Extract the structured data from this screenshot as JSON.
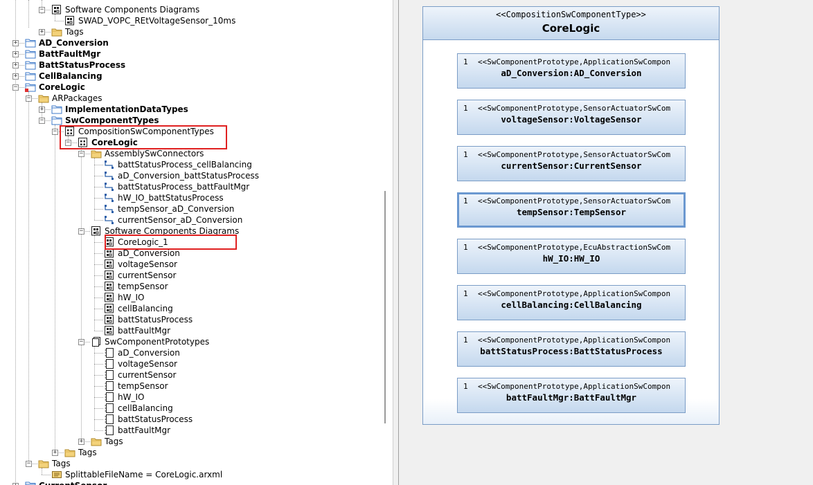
{
  "tree": {
    "nodes": [
      {
        "label": "Software Components Diagrams",
        "icon": "diagram-icon",
        "toggle": "-",
        "bold": false
      },
      {
        "label": "SWAD_VOPC_REtVoltageSensor_10ms",
        "icon": "diagram-icon",
        "toggle": "",
        "bold": false
      },
      {
        "label": "Tags",
        "icon": "tags-folder-icon",
        "toggle": "+",
        "bold": false
      },
      {
        "label": "AD_Conversion",
        "icon": "package-folder-icon",
        "toggle": "+",
        "bold": true
      },
      {
        "label": "BattFaultMgr",
        "icon": "package-folder-icon",
        "toggle": "+",
        "bold": true
      },
      {
        "label": "BattStatusProcess",
        "icon": "package-folder-icon",
        "toggle": "+",
        "bold": true
      },
      {
        "label": "CellBalancing",
        "icon": "package-folder-icon",
        "toggle": "+",
        "bold": true
      },
      {
        "label": "CoreLogic",
        "icon": "package-folder-modified-icon",
        "toggle": "-",
        "bold": true
      },
      {
        "label": "ARPackages",
        "icon": "folder-icon",
        "toggle": "-",
        "bold": false
      },
      {
        "label": "ImplementationDataTypes",
        "icon": "package-folder-icon",
        "toggle": "+",
        "bold": true
      },
      {
        "label": "SwComponentTypes",
        "icon": "package-folder-icon",
        "toggle": "-",
        "bold": true
      },
      {
        "label": "CompositionSwComponentTypes",
        "icon": "composition-icon",
        "toggle": "-",
        "bold": false
      },
      {
        "label": "CoreLogic",
        "icon": "composition-icon",
        "toggle": "-",
        "bold": true
      },
      {
        "label": "AssemblySwConnectors",
        "icon": "folder-icon",
        "toggle": "-",
        "bold": false
      },
      {
        "label": "battStatusProcess_cellBalancing",
        "icon": "connector-icon",
        "toggle": "",
        "bold": false
      },
      {
        "label": "aD_Conversion_battStatusProcess",
        "icon": "connector-icon",
        "toggle": "",
        "bold": false
      },
      {
        "label": "battStatusProcess_battFaultMgr",
        "icon": "connector-icon",
        "toggle": "",
        "bold": false
      },
      {
        "label": "hW_IO_battStatusProcess",
        "icon": "connector-icon",
        "toggle": "",
        "bold": false
      },
      {
        "label": "tempSensor_aD_Conversion",
        "icon": "connector-icon",
        "toggle": "",
        "bold": false
      },
      {
        "label": "currentSensor_aD_Conversion",
        "icon": "connector-icon",
        "toggle": "",
        "bold": false
      },
      {
        "label": "Software Components Diagrams",
        "icon": "diagram-icon",
        "toggle": "-",
        "bold": false
      },
      {
        "label": "CoreLogic_1",
        "icon": "diagram-icon",
        "toggle": "",
        "bold": false
      },
      {
        "label": "aD_Conversion",
        "icon": "diagram-icon",
        "toggle": "",
        "bold": false
      },
      {
        "label": "voltageSensor",
        "icon": "diagram-icon",
        "toggle": "",
        "bold": false
      },
      {
        "label": "currentSensor",
        "icon": "diagram-icon",
        "toggle": "",
        "bold": false
      },
      {
        "label": "tempSensor",
        "icon": "diagram-icon",
        "toggle": "",
        "bold": false
      },
      {
        "label": "hW_IO",
        "icon": "diagram-icon",
        "toggle": "",
        "bold": false
      },
      {
        "label": "cellBalancing",
        "icon": "diagram-icon",
        "toggle": "",
        "bold": false
      },
      {
        "label": "battStatusProcess",
        "icon": "diagram-icon",
        "toggle": "",
        "bold": false
      },
      {
        "label": "battFaultMgr",
        "icon": "diagram-icon",
        "toggle": "",
        "bold": false
      },
      {
        "label": "SwComponentPrototypes",
        "icon": "prototypes-icon",
        "toggle": "-",
        "bold": false
      },
      {
        "label": "aD_Conversion",
        "icon": "prototype-icon",
        "toggle": "",
        "bold": false
      },
      {
        "label": "voltageSensor",
        "icon": "prototype-icon",
        "toggle": "",
        "bold": false
      },
      {
        "label": "currentSensor",
        "icon": "prototype-icon",
        "toggle": "",
        "bold": false
      },
      {
        "label": "tempSensor",
        "icon": "prototype-icon",
        "toggle": "",
        "bold": false
      },
      {
        "label": "hW_IO",
        "icon": "prototype-icon",
        "toggle": "",
        "bold": false
      },
      {
        "label": "cellBalancing",
        "icon": "prototype-icon",
        "toggle": "",
        "bold": false
      },
      {
        "label": "battStatusProcess",
        "icon": "prototype-icon",
        "toggle": "",
        "bold": false
      },
      {
        "label": "battFaultMgr",
        "icon": "prototype-icon",
        "toggle": "",
        "bold": false
      },
      {
        "label": "Tags",
        "icon": "tags-folder-icon",
        "toggle": "+",
        "bold": false
      },
      {
        "label": "Tags",
        "icon": "tags-folder-icon",
        "toggle": "+",
        "bold": false
      },
      {
        "label": "Tags",
        "icon": "tags-folder-icon",
        "toggle": "-",
        "bold": false
      },
      {
        "label": "SplittableFileName = CoreLogic.arxml",
        "icon": "tag-icon",
        "toggle": "",
        "bold": false
      },
      {
        "label": "CurrentSensor",
        "icon": "package-folder-icon",
        "toggle": "+",
        "bold": true
      }
    ]
  },
  "diagram": {
    "composite": {
      "stereotype": "<<CompositionSwComponentType>>",
      "name": "CoreLogic"
    },
    "prototypes": [
      {
        "multiplicity": "1",
        "stereotype": "<<SwComponentPrototype,ApplicationSwCompon",
        "name": "aD_Conversion:AD_Conversion",
        "selected": false
      },
      {
        "multiplicity": "1",
        "stereotype": "<<SwComponentPrototype,SensorActuatorSwCom",
        "name": "voltageSensor:VoltageSensor",
        "selected": false
      },
      {
        "multiplicity": "1",
        "stereotype": "<<SwComponentPrototype,SensorActuatorSwCom",
        "name": "currentSensor:CurrentSensor",
        "selected": false
      },
      {
        "multiplicity": "1",
        "stereotype": "<<SwComponentPrototype,SensorActuatorSwCom",
        "name": "tempSensor:TempSensor",
        "selected": true
      },
      {
        "multiplicity": "1",
        "stereotype": "<<SwComponentPrototype,EcuAbstractionSwCom",
        "name": "hW_IO:HW_IO",
        "selected": false
      },
      {
        "multiplicity": "1",
        "stereotype": "<<SwComponentPrototype,ApplicationSwCompon",
        "name": "cellBalancing:CellBalancing",
        "selected": false
      },
      {
        "multiplicity": "1",
        "stereotype": "<<SwComponentPrototype,ApplicationSwCompon",
        "name": "battStatusProcess:BattStatusProcess",
        "selected": false
      },
      {
        "multiplicity": "1",
        "stereotype": "<<SwComponentPrototype,ApplicationSwCompon",
        "name": "battFaultMgr:BattFaultMgr",
        "selected": false
      }
    ]
  },
  "colors": {
    "highlight": "#e02020",
    "box_border": "#7a9cc6",
    "box_fill_top": "#eef4fb",
    "box_fill_bottom": "#c4d8ee",
    "folder_yellow": "#f3d27a",
    "package_blue": "#3c78c8"
  }
}
